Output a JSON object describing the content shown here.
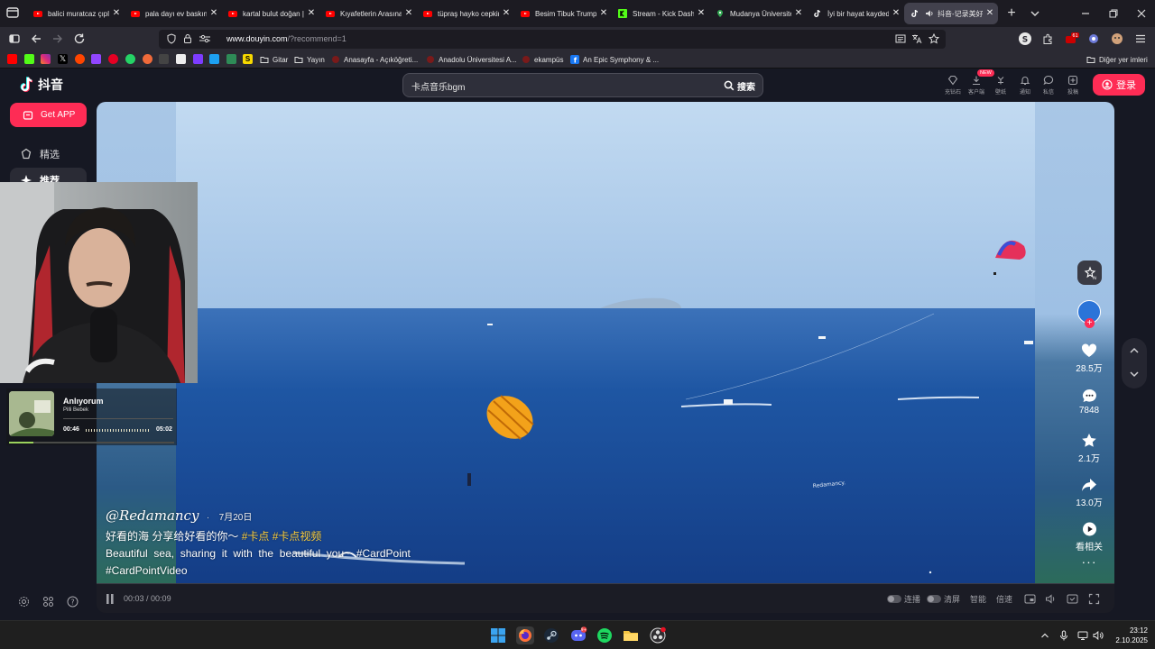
{
  "browser": {
    "tabs": [
      {
        "title": "balici muratcaz çıplak",
        "icon": "youtube-icon"
      },
      {
        "title": "pala dayı ev baskını",
        "icon": "youtube-icon"
      },
      {
        "title": "kartal bulut doğan | sec",
        "icon": "youtube-icon"
      },
      {
        "title": "Kıyafetlerin Arasına",
        "icon": "youtube-icon"
      },
      {
        "title": "tüpraş hayko cepkin",
        "icon": "youtube-icon"
      },
      {
        "title": "Besim Tibuk Trump",
        "icon": "youtube-icon"
      },
      {
        "title": "Stream - Kick Dashb",
        "icon": "kick-icon"
      },
      {
        "title": "Mudanya Üniversitesi",
        "icon": "maps-icon"
      },
      {
        "title": "İyi bir hayat kaydediyo",
        "icon": "tiktok-icon"
      },
      {
        "title": "抖音-记录美好生活",
        "icon": "tiktok-icon",
        "active": true
      }
    ],
    "url_host": "www.douyin.com",
    "url_path": "/?recommend=1",
    "bookmarks": [
      {
        "label": "Gitar",
        "icon": "folder-icon"
      },
      {
        "label": "Yayın",
        "icon": "folder-icon"
      },
      {
        "label": "Anasayfa - Açıköğreti...",
        "icon": "site-icon"
      },
      {
        "label": "Anadolu Üniversitesi A...",
        "icon": "site-icon"
      },
      {
        "label": "ekampüs",
        "icon": "site-icon"
      },
      {
        "label": "An Epic Symphony & ...",
        "icon": "facebook-icon"
      }
    ],
    "other_bookmarks": "Diğer yer imleri"
  },
  "douyin": {
    "logo_text": "抖音",
    "search_value": "卡点音乐bgm",
    "search_button": "搜索",
    "header_items": [
      {
        "label": "充钻石",
        "icon": "diamond-icon"
      },
      {
        "label": "客户端",
        "icon": "download-icon",
        "badge": "NEW"
      },
      {
        "label": "壁纸",
        "icon": "wallpaper-icon"
      },
      {
        "label": "通知",
        "icon": "bell-icon"
      },
      {
        "label": "私信",
        "icon": "message-icon"
      },
      {
        "label": "投稿",
        "icon": "upload-icon"
      }
    ],
    "login_label": "登录",
    "get_app": "Get APP",
    "sidebar": [
      {
        "label": "精选",
        "icon": "featured-icon"
      },
      {
        "label": "推荐",
        "icon": "recommend-icon",
        "active": true
      }
    ],
    "video": {
      "author": "@Redamancy",
      "date": "7月20日",
      "line1": "好看的海 分享给好看的你～",
      "tags1": [
        "#卡点",
        "#卡点视频"
      ],
      "line2": "Beautiful  sea,  sharing  it  with  the  beautiful  you~  #CardPoint",
      "line3": "#CardPointVideo",
      "watermark": "Redamancy.",
      "current_time": "00:03",
      "duration": "00:09"
    },
    "actions": [
      {
        "label": "28.5万",
        "icon": "heart-icon"
      },
      {
        "label": "7848",
        "icon": "comment-icon"
      },
      {
        "label": "2.1万",
        "icon": "star-icon"
      },
      {
        "label": "13.0万",
        "icon": "share-icon"
      },
      {
        "label": "看相关",
        "icon": "related-icon"
      }
    ],
    "controls": {
      "autoplay": "连播",
      "clear": "清屏",
      "quality": "智能",
      "speed": "倍速"
    }
  },
  "overlay": {
    "now_playing": {
      "status": "Anlıyorum",
      "artist": "Pilli Bebek",
      "current": "00:46",
      "duration": "05:02",
      "progress": 0.15
    }
  },
  "taskbar": {
    "time": "23:12",
    "date": "2.10.2025"
  },
  "colors": {
    "accent": "#fe2c55",
    "tag": "#facd3c"
  }
}
